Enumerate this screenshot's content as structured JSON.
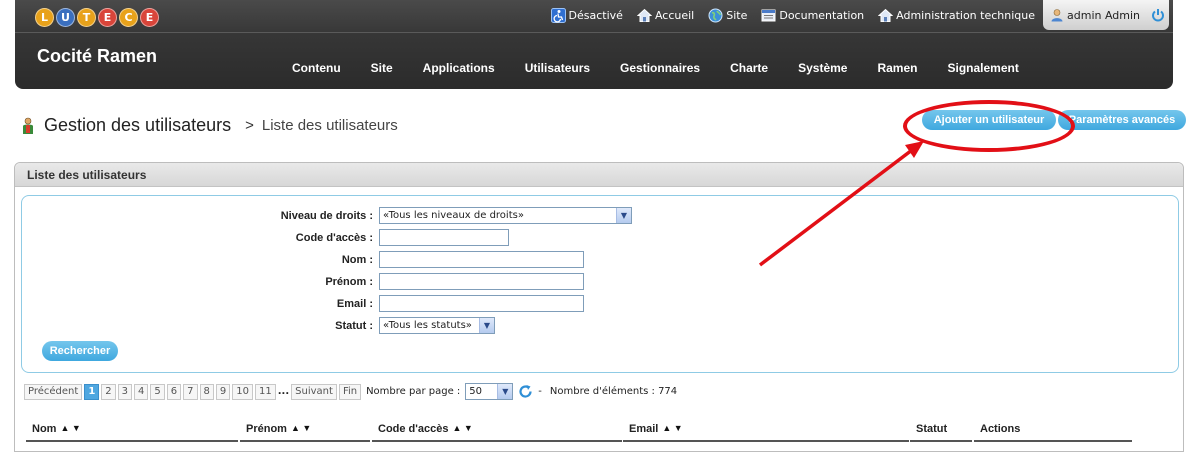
{
  "header": {
    "logo_letters": [
      "L",
      "U",
      "T",
      "E",
      "C",
      "E"
    ],
    "logo_colors": [
      "#e8a21b",
      "#3a6fbf",
      "#e8a21b",
      "#d9453a",
      "#e8a21b",
      "#d9453a"
    ],
    "site_name": "Cocité Ramen",
    "top_links": [
      {
        "label": "Désactivé",
        "icon": "accessibility-icon"
      },
      {
        "label": "Accueil",
        "icon": "home-icon"
      },
      {
        "label": "Site",
        "icon": "globe-icon"
      },
      {
        "label": "Documentation",
        "icon": "document-icon"
      },
      {
        "label": "Administration technique",
        "icon": "home-icon"
      }
    ],
    "user_label": "admin Admin",
    "nav": [
      "Contenu",
      "Site",
      "Applications",
      "Utilisateurs",
      "Gestionnaires",
      "Charte",
      "Système",
      "Ramen",
      "Signalement"
    ]
  },
  "page": {
    "title": "Gestion des utilisateurs",
    "separator": ">",
    "subtitle": "Liste des utilisateurs",
    "add_user_label": "Ajouter un utilisateur",
    "advanced_label": "Paramètres avancés"
  },
  "panel": {
    "title": "Liste des utilisateurs",
    "filters": {
      "level_label": "Niveau de droits :",
      "level_value": "«Tous les niveaux de droits»",
      "access_code_label": "Code d'accès :",
      "access_code_value": "",
      "last_name_label": "Nom :",
      "last_name_value": "",
      "first_name_label": "Prénom :",
      "first_name_value": "",
      "email_label": "Email :",
      "email_value": "",
      "status_label": "Statut :",
      "status_value": "«Tous les statuts»"
    },
    "search_label": "Rechercher"
  },
  "pager": {
    "prev": "Précédent",
    "pages": [
      "1",
      "2",
      "3",
      "4",
      "5",
      "6",
      "7",
      "8",
      "9",
      "10",
      "11"
    ],
    "ellipsis": "...",
    "next": "Suivant",
    "last": "Fin",
    "per_page_label": "Nombre par page :",
    "per_page_value": "50",
    "count_separator": "-",
    "count_label": "Nombre d'éléments : 774"
  },
  "table": {
    "columns": [
      "Nom",
      "Prénom",
      "Code d'accès",
      "Email",
      "Statut",
      "Actions"
    ]
  },
  "colors": {
    "accent_blue": "#4fa7e0",
    "highlight_red": "#e20f16",
    "header_dark": "#333333"
  }
}
